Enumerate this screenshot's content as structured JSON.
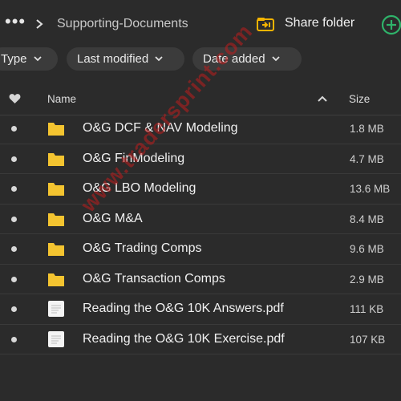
{
  "topbar": {
    "more_icon": "more-dots-icon",
    "breadcrumb": "Supporting-Documents",
    "share_label": "Share folder",
    "share_color": "#f5b400",
    "add_color": "#2fb36a"
  },
  "filters": {
    "type_label": "Type",
    "modified_label": "Last modified",
    "date_added_label": "Date added"
  },
  "table": {
    "headers": {
      "name": "Name",
      "size": "Size"
    },
    "rows": [
      {
        "name": "O&G DCF & NAV Modeling",
        "size": "1.8 MB",
        "kind": "folder"
      },
      {
        "name": "O&G FinModeling",
        "size": "4.7 MB",
        "kind": "folder"
      },
      {
        "name": "O&G LBO Modeling",
        "size": "13.6 MB",
        "kind": "folder"
      },
      {
        "name": "O&G M&A",
        "size": "8.4 MB",
        "kind": "folder"
      },
      {
        "name": "O&G Trading Comps",
        "size": "9.6 MB",
        "kind": "folder"
      },
      {
        "name": "O&G Transaction Comps",
        "size": "2.9 MB",
        "kind": "folder"
      },
      {
        "name": "Reading the O&G 10K Answers.pdf",
        "size": "111 KB",
        "kind": "pdf"
      },
      {
        "name": "Reading the O&G 10K Exercise.pdf",
        "size": "107 KB",
        "kind": "pdf"
      }
    ]
  },
  "watermark": "www.tradersprint.com",
  "colors": {
    "background": "#2b2b2b",
    "folder": "#f4c430",
    "chip": "#3b3b3b"
  }
}
